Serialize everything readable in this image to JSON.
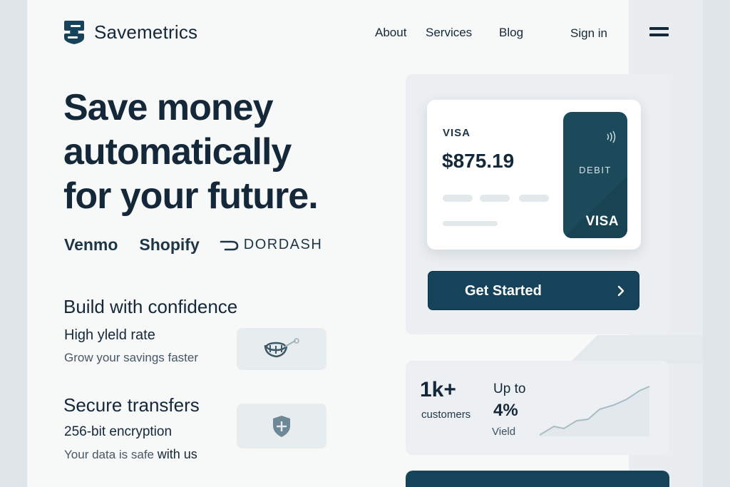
{
  "brand": {
    "name": "Savemetrics",
    "logo_icon": "s-shield-logo",
    "color": "#17435a"
  },
  "nav": {
    "about": "About",
    "services": "Services",
    "blog": "Blog",
    "sign_in": "Sign in",
    "menu_icon": "hamburger-icon"
  },
  "hero": {
    "line1": "Save money",
    "line2": "automatically",
    "line3": "for your future."
  },
  "partners": {
    "venmo": "Venmo",
    "shopify": "Shopify",
    "doordash": "DORDASH"
  },
  "features": {
    "heading": "Build with confidence",
    "yield_title": "High yleld rate",
    "yield_sub": "Grow your savings faster",
    "yield_icon": "coin-growth-icon",
    "secure_heading": "Secure transfers",
    "secure_title": "256-bit encryption",
    "secure_sub_a": "Your data is safe",
    "secure_sub_b": "with us",
    "secure_icon": "shield-plus-icon"
  },
  "card": {
    "network": "VISA",
    "balance": "$875.19",
    "debit_label": "DEBIT",
    "debit_network": "VISA",
    "nfc_icon": "contactless-icon"
  },
  "cta": {
    "label": "Get Started",
    "icon": "chevron-right-icon"
  },
  "stats": {
    "customers_value": "1k+",
    "customers_label": "customers",
    "yield_prefix": "Up to",
    "yield_value": "4%",
    "yield_label": "Vield"
  },
  "colors": {
    "dark": "#14283a",
    "accent": "#17435a",
    "panel": "#eceff1"
  }
}
